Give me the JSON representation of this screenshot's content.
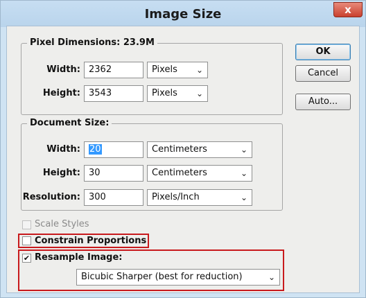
{
  "window": {
    "title": "Image Size",
    "close_glyph": "x"
  },
  "buttons": {
    "ok": "OK",
    "cancel": "Cancel",
    "auto": "Auto..."
  },
  "pixel_dimensions": {
    "legend": "Pixel Dimensions:  23.9M",
    "width_label": "Width:",
    "width_value": "2362",
    "width_unit": "Pixels",
    "height_label": "Height:",
    "height_value": "3543",
    "height_unit": "Pixels"
  },
  "document_size": {
    "legend": "Document Size:",
    "width_label": "Width:",
    "width_value": "20",
    "width_unit": "Centimeters",
    "height_label": "Height:",
    "height_value": "30",
    "height_unit": "Centimeters",
    "resolution_label": "Resolution:",
    "resolution_value": "300",
    "resolution_unit": "Pixels/Inch"
  },
  "options": {
    "scale_styles": {
      "label": "Scale Styles",
      "checked": false,
      "enabled": false
    },
    "constrain_proportions": {
      "label": "Constrain Proportions",
      "checked": false
    },
    "resample_image": {
      "label": "Resample Image:",
      "checked": true
    },
    "resample_method": "Bicubic Sharper (best for reduction)"
  },
  "colors": {
    "highlight": "#c8191c",
    "selection": "#3399ff"
  },
  "icons": {
    "dropdown": "chevron-down-icon",
    "check": "checkmark-icon"
  }
}
